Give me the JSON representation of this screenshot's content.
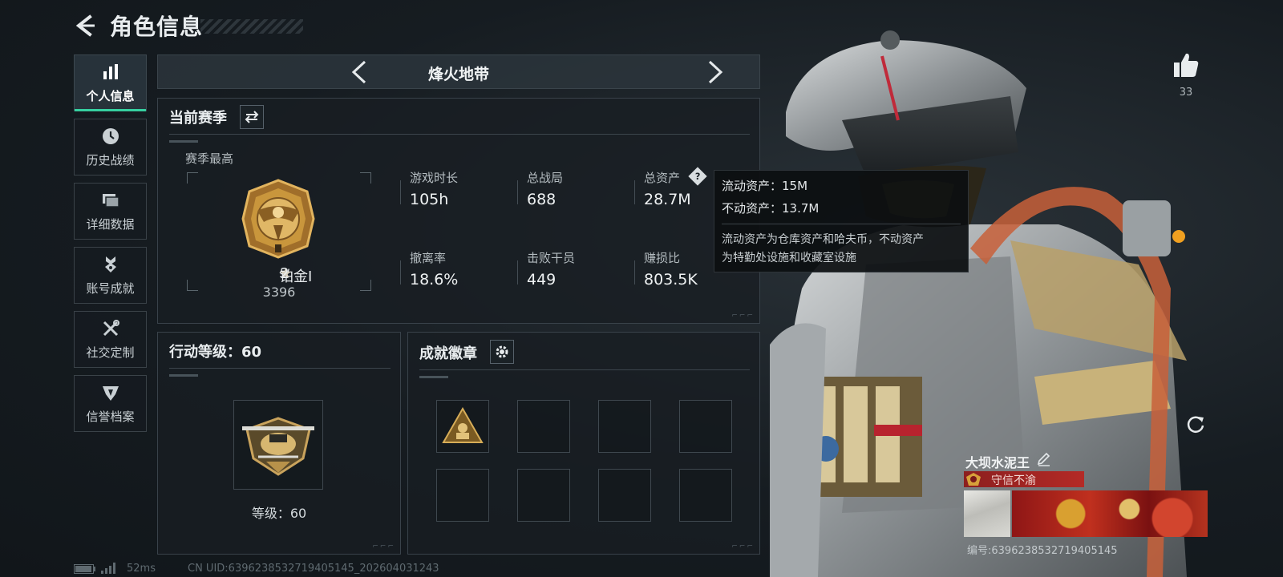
{
  "header": {
    "title": "角色信息"
  },
  "nav": [
    {
      "label": "个人信息",
      "icon": "bar-chart-icon",
      "active": true
    },
    {
      "label": "历史战绩",
      "icon": "clock-icon"
    },
    {
      "label": "详细数据",
      "icon": "cards-icon"
    },
    {
      "label": "账号成就",
      "icon": "medal-icon"
    },
    {
      "label": "社交定制",
      "icon": "wrench-icon"
    },
    {
      "label": "信誉档案",
      "icon": "shield-icon"
    }
  ],
  "mode": {
    "title": "烽火地带"
  },
  "season": {
    "title": "当前赛季",
    "highest_label": "赛季最高",
    "rank_name": "铂金I",
    "rank_stars": "2",
    "rank_points": "3396",
    "stats": [
      {
        "label": "游戏时长",
        "value": "105h"
      },
      {
        "label": "总战局",
        "value": "688"
      },
      {
        "label": "总资产",
        "value": "28.7M"
      },
      {
        "label": "撤离率",
        "value": "18.6%"
      },
      {
        "label": "击败干员",
        "value": "449"
      },
      {
        "label": "赚损比",
        "value": "803.5K"
      }
    ]
  },
  "tooltip": {
    "liquid": "流动资产：15M",
    "fixed": "不动资产：13.7M",
    "desc_1": "流动资产为仓库资产和哈夫币，不动资产",
    "desc_2": "为特勤处设施和收藏室设施"
  },
  "level": {
    "title": "行动等级：60",
    "caption": "等级：60"
  },
  "badges": {
    "title": "成就徽章"
  },
  "likes": {
    "count": "33"
  },
  "player": {
    "name": "大坝水泥王",
    "reputation": "守信不渝",
    "id": "编号:6396238532719405145"
  },
  "footer": {
    "ping": "52ms",
    "uid": "CN UID:6396238532719405145_202604031243"
  },
  "colors": {
    "accent": "#36d0a0",
    "rank_gold": "#c9963c",
    "reputation_red": "#b42a26"
  }
}
